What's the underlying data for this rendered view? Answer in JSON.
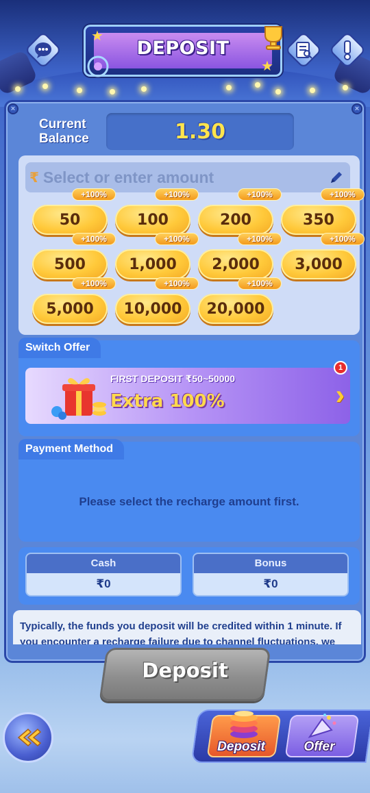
{
  "header": {
    "title": "DEPOSIT",
    "left_icon": "customer-service-icon",
    "right_icons": [
      "records-icon",
      "info-icon"
    ]
  },
  "balance": {
    "label_line1": "Current",
    "label_line2": "Balance",
    "value": "1.30",
    "value_color": "#ffe44d"
  },
  "amount": {
    "currency_icon": "₹",
    "placeholder": "Select or enter amount",
    "options": [
      {
        "value": "50",
        "bonus": "+100%"
      },
      {
        "value": "100",
        "bonus": "+100%"
      },
      {
        "value": "200",
        "bonus": "+100%"
      },
      {
        "value": "350",
        "bonus": "+100%"
      },
      {
        "value": "500",
        "bonus": "+100%"
      },
      {
        "value": "1,000",
        "bonus": "+100%"
      },
      {
        "value": "2,000",
        "bonus": "+100%"
      },
      {
        "value": "3,000",
        "bonus": "+100%"
      },
      {
        "value": "5,000",
        "bonus": "+100%"
      },
      {
        "value": "10,000",
        "bonus": "+100%"
      },
      {
        "value": "20,000",
        "bonus": "+100%"
      }
    ]
  },
  "offer": {
    "section_title": "Switch Offer",
    "banner_title": "FIRST DEPOSIT ₹50~50000",
    "banner_extra": "Extra 100%",
    "badge_count": "1"
  },
  "payment": {
    "section_title": "Payment Method",
    "message": "Please select the recharge amount first."
  },
  "wallet": {
    "cash_label": "Cash",
    "cash_value": "₹0",
    "bonus_label": "Bonus",
    "bonus_value": "₹0"
  },
  "notice": {
    "text": "Typically, the funds you deposit will be credited within 1 minute. If you encounter a recharge failure due to channel fluctuations, we"
  },
  "deposit_button": {
    "label": "Deposit"
  },
  "bottom_nav": {
    "items": [
      {
        "label": "Deposit",
        "active": true
      },
      {
        "label": "Offer",
        "active": false
      }
    ]
  },
  "colors": {
    "accent_gold": "#ffc93a",
    "panel_blue": "#5b86d8",
    "section_blue": "#4a8af0",
    "disabled_gray": "#8e8e8e"
  }
}
